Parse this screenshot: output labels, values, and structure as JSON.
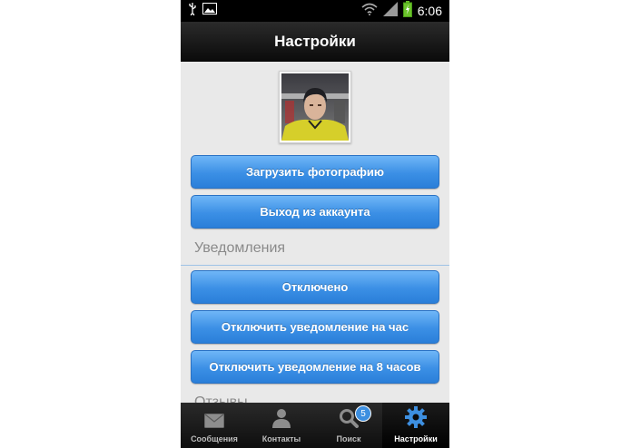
{
  "status_bar": {
    "time": "6:06",
    "left_icons": [
      "usb-icon",
      "image-icon"
    ],
    "right_icons": [
      "wifi-icon",
      "signal-icon",
      "battery-charging-icon"
    ]
  },
  "header": {
    "title": "Настройки"
  },
  "profile": {
    "avatar": "avatar"
  },
  "buttons": {
    "upload_photo": "Загрузить фотографию",
    "logout": "Выход из аккаунта"
  },
  "notifications": {
    "section_title": "Уведомления",
    "options": [
      "Отключено",
      "Отключить уведомление на час",
      "Отключить уведомление на 8 часов"
    ]
  },
  "next_section": {
    "title": "Отзывы"
  },
  "tabbar": {
    "tabs": [
      {
        "label": "Сообщения",
        "icon": "envelope-icon"
      },
      {
        "label": "Контакты",
        "icon": "person-icon"
      },
      {
        "label": "Поиск",
        "icon": "search-icon",
        "badge": "5"
      },
      {
        "label": "Настройки",
        "icon": "gear-icon",
        "active": true
      }
    ]
  },
  "colors": {
    "button_blue": "#3b8fe5",
    "background": "#e9e9e9",
    "header": "#0b0b0b",
    "badge_blue": "#3d8fe0"
  }
}
